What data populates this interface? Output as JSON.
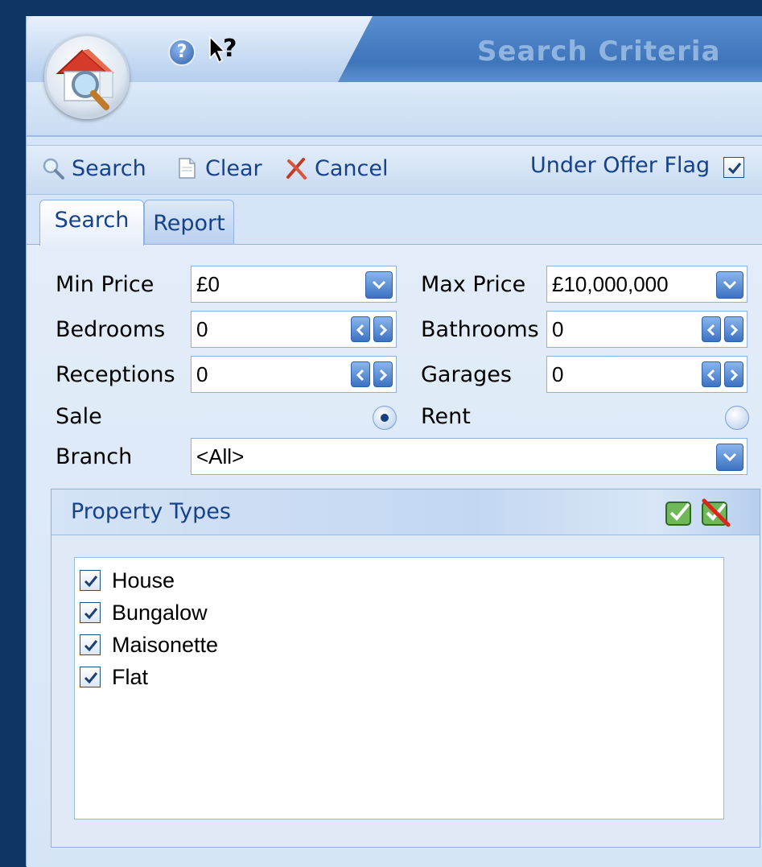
{
  "window": {
    "title": "Search Criteria"
  },
  "toolbar": {
    "search_label": "Search",
    "clear_label": "Clear",
    "cancel_label": "Cancel",
    "under_offer_label": "Under Offer Flag",
    "under_offer_checked": true
  },
  "tabs": [
    {
      "label": "Search",
      "active": true
    },
    {
      "label": "Report",
      "active": false
    }
  ],
  "form": {
    "min_price": {
      "label": "Min Price",
      "value": "£0"
    },
    "max_price": {
      "label": "Max Price",
      "value": "£10,000,000"
    },
    "bedrooms": {
      "label": "Bedrooms",
      "value": "0"
    },
    "bathrooms": {
      "label": "Bathrooms",
      "value": "0"
    },
    "receptions": {
      "label": "Receptions",
      "value": "0"
    },
    "garages": {
      "label": "Garages",
      "value": "0"
    },
    "sale": {
      "label": "Sale",
      "selected": true
    },
    "rent": {
      "label": "Rent",
      "selected": false
    },
    "branch": {
      "label": "Branch",
      "value": "<All>"
    }
  },
  "property_types": {
    "title": "Property Types",
    "items": [
      {
        "label": "House",
        "checked": true
      },
      {
        "label": "Bungalow",
        "checked": true
      },
      {
        "label": "Maisonette",
        "checked": true
      },
      {
        "label": "Flat",
        "checked": true
      }
    ]
  },
  "icons": {
    "logo": "house-search-logo",
    "help": "help-icon",
    "whats_this": "whats-this-icon"
  },
  "colors": {
    "accent": "#15428b",
    "title_text": "#8fb4e0",
    "frame": "#0e3563"
  }
}
